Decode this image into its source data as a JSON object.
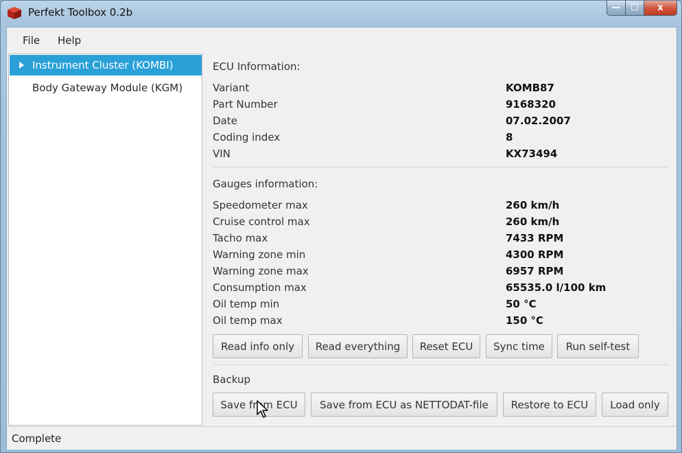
{
  "window": {
    "title": "Perfekt Toolbox 0.2b",
    "minimize": "—",
    "maximize": "☐",
    "close": "x"
  },
  "menu": {
    "file": "File",
    "help": "Help"
  },
  "sidebar": {
    "items": [
      {
        "label": "Instrument Cluster (KOMBI)",
        "selected": true
      },
      {
        "label": "Body Gateway Module (KGM)",
        "selected": false
      }
    ]
  },
  "ecu": {
    "heading": "ECU Information:",
    "rows": [
      {
        "label": "Variant",
        "value": "KOMB87"
      },
      {
        "label": "Part Number",
        "value": "9168320"
      },
      {
        "label": "Date",
        "value": "07.02.2007"
      },
      {
        "label": "Coding index",
        "value": "8"
      },
      {
        "label": "VIN",
        "value": "KX73494"
      }
    ]
  },
  "gauges": {
    "heading": "Gauges information:",
    "rows": [
      {
        "label": "Speedometer max",
        "value": "260 km/h"
      },
      {
        "label": "Cruise control max",
        "value": "260 km/h"
      },
      {
        "label": "Tacho max",
        "value": "7433 RPM"
      },
      {
        "label": "Warning zone min",
        "value": "4300 RPM"
      },
      {
        "label": "Warning zone max",
        "value": "6957 RPM"
      },
      {
        "label": "Consumption max",
        "value": "65535.0 l/100 km"
      },
      {
        "label": "Oil temp min",
        "value": "50 °C"
      },
      {
        "label": "Oil temp max",
        "value": "150 °C"
      }
    ]
  },
  "actions": {
    "read_info": "Read info only",
    "read_everything": "Read everything",
    "reset_ecu": "Reset ECU",
    "sync_time": "Sync time",
    "self_test": "Run self-test"
  },
  "backup": {
    "heading": "Backup",
    "save_from_ecu": "Save from ECU",
    "save_nettodat": "Save from ECU as NETTODAT-file",
    "restore": "Restore to ECU",
    "load_only": "Load only"
  },
  "status": {
    "text": "Complete"
  },
  "colors": {
    "selection": "#2aa0d8",
    "close_button": "#c23a22",
    "title_gradient": "#a7c5de"
  },
  "icons": {
    "app": "red-cube-icon",
    "tree_expand": "triangle-right-icon",
    "cursor": "mouse-pointer-icon"
  }
}
